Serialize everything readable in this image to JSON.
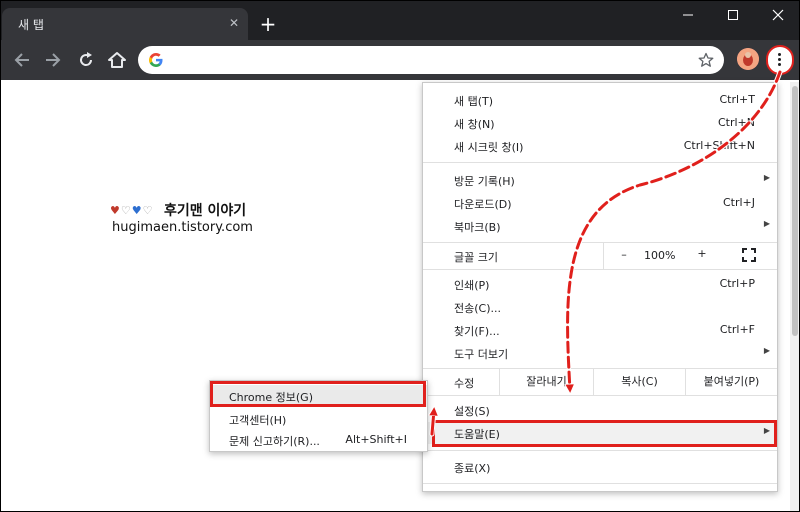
{
  "tab": {
    "title": "새 탭",
    "close_glyph": "✕",
    "new_tab_glyph": "+"
  },
  "window_controls": {
    "minimize": "—",
    "maximize": "☐",
    "close": "✕"
  },
  "page": {
    "hearts": "♥♡♥♡",
    "blog_title": "후기맨 이야기",
    "blog_url": "hugimaen.tistory.com"
  },
  "menu": {
    "new_tab": {
      "label": "새 탭(T)",
      "shortcut": "Ctrl+T"
    },
    "new_window": {
      "label": "새 창(N)",
      "shortcut": "Ctrl+N"
    },
    "incognito": {
      "label": "새 시크릿 창(I)",
      "shortcut": "Ctrl+Shift+N"
    },
    "history": {
      "label": "방문 기록(H)"
    },
    "downloads": {
      "label": "다운로드(D)",
      "shortcut": "Ctrl+J"
    },
    "bookmarks": {
      "label": "북마크(B)"
    },
    "zoom": {
      "label": "글꼴 크기",
      "minus": "–",
      "value": "100%",
      "plus": "+"
    },
    "print": {
      "label": "인쇄(P)",
      "shortcut": "Ctrl+P"
    },
    "cast": {
      "label": "전송(C)..."
    },
    "find": {
      "label": "찾기(F)...",
      "shortcut": "Ctrl+F"
    },
    "more_tools": {
      "label": "도구 더보기"
    },
    "edit": {
      "label": "수정",
      "cut": "잘라내기",
      "copy": "복사(C)",
      "paste": "붙여넣기(P)"
    },
    "settings": {
      "label": "설정(S)"
    },
    "help": {
      "label": "도움말(E)"
    },
    "exit": {
      "label": "종료(X)"
    },
    "arrow_glyph": "▶"
  },
  "help_submenu": {
    "about": {
      "label": "Chrome 정보(G)"
    },
    "help_center": {
      "label": "고객센터(H)"
    },
    "report": {
      "label": "문제 신고하기(R)...",
      "shortcut": "Alt+Shift+I"
    }
  },
  "colors": {
    "titlebar": "#202124",
    "toolbar": "#35363a",
    "highlight": "#e0201c"
  }
}
